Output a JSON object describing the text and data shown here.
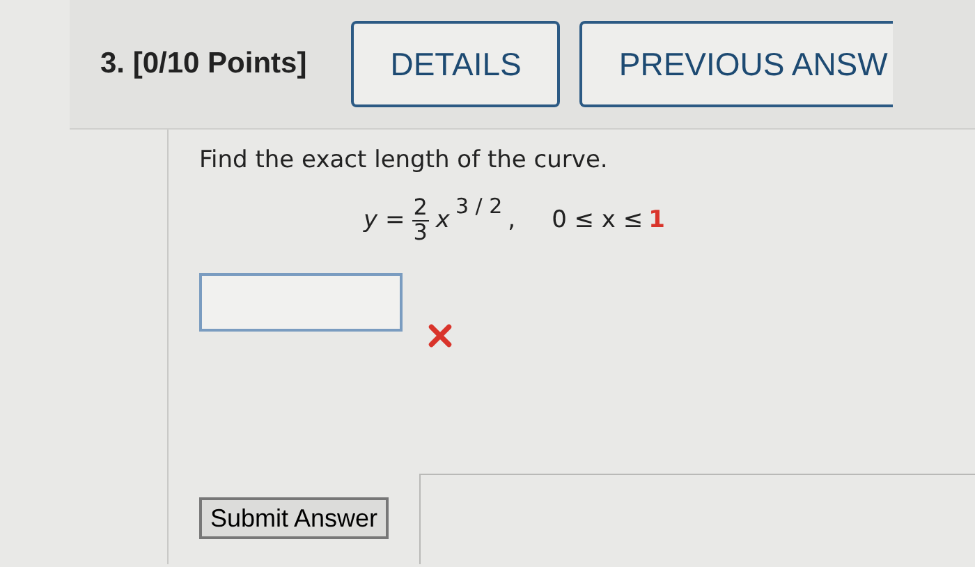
{
  "question": {
    "number": "3.",
    "points": "[0/10 Points]"
  },
  "header_buttons": [
    {
      "label": "DETAILS",
      "cut_off": false
    },
    {
      "label": "PREVIOUS ANSW",
      "cut_off": true
    }
  ],
  "prompt": "Find the exact length of the curve.",
  "equation": {
    "lhs": "y =",
    "numerator": "2",
    "denominator": "3",
    "base": "x",
    "exponent": "3 / 2",
    "separator": ",",
    "range": "0 ≤ x ≤",
    "upper_limit": "1"
  },
  "answer": {
    "incorrect": true
  },
  "submit_button": "Submit Answer"
}
